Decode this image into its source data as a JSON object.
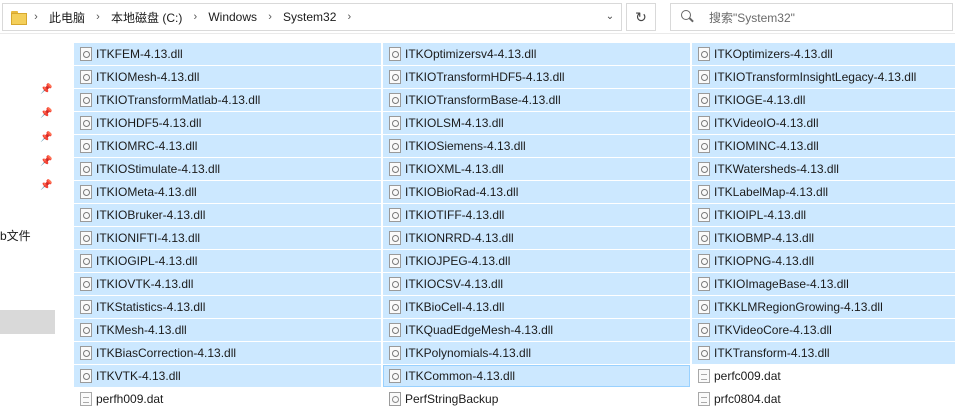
{
  "address": {
    "crumbs": [
      "此电脑",
      "本地磁盘 (C:)",
      "Windows",
      "System32"
    ],
    "dropdown_icon": "chevron-down-icon"
  },
  "refresh_icon": "refresh-icon",
  "search": {
    "placeholder": "搜索\"System32\""
  },
  "nav": {
    "partial_label": "b文件"
  },
  "files": [
    [
      {
        "name": "ITKFEM-4.13.dll",
        "icon": "dll",
        "state": "sel"
      },
      {
        "name": "ITKOptimizersv4-4.13.dll",
        "icon": "dll",
        "state": "sel"
      },
      {
        "name": "ITKOptimizers-4.13.dll",
        "icon": "dll",
        "state": "sel"
      }
    ],
    [
      {
        "name": "ITKIOMesh-4.13.dll",
        "icon": "dll",
        "state": "sel"
      },
      {
        "name": "ITKIOTransformHDF5-4.13.dll",
        "icon": "dll",
        "state": "sel"
      },
      {
        "name": "ITKIOTransformInsightLegacy-4.13.dll",
        "icon": "dll",
        "state": "sel"
      }
    ],
    [
      {
        "name": "ITKIOTransformMatlab-4.13.dll",
        "icon": "dll",
        "state": "sel"
      },
      {
        "name": "ITKIOTransformBase-4.13.dll",
        "icon": "dll",
        "state": "sel"
      },
      {
        "name": "ITKIOGE-4.13.dll",
        "icon": "dll",
        "state": "sel"
      }
    ],
    [
      {
        "name": "ITKIOHDF5-4.13.dll",
        "icon": "dll",
        "state": "sel"
      },
      {
        "name": "ITKIOLSM-4.13.dll",
        "icon": "dll",
        "state": "sel"
      },
      {
        "name": "ITKVideoIO-4.13.dll",
        "icon": "dll",
        "state": "sel"
      }
    ],
    [
      {
        "name": "ITKIOMRC-4.13.dll",
        "icon": "dll",
        "state": "sel"
      },
      {
        "name": "ITKIOSiemens-4.13.dll",
        "icon": "dll",
        "state": "sel"
      },
      {
        "name": "ITKIOMINC-4.13.dll",
        "icon": "dll",
        "state": "sel"
      }
    ],
    [
      {
        "name": "ITKIOStimulate-4.13.dll",
        "icon": "dll",
        "state": "sel"
      },
      {
        "name": "ITKIOXML-4.13.dll",
        "icon": "dll",
        "state": "sel"
      },
      {
        "name": "ITKWatersheds-4.13.dll",
        "icon": "dll",
        "state": "sel"
      }
    ],
    [
      {
        "name": "ITKIOMeta-4.13.dll",
        "icon": "dll",
        "state": "sel"
      },
      {
        "name": "ITKIOBioRad-4.13.dll",
        "icon": "dll",
        "state": "sel"
      },
      {
        "name": "ITKLabelMap-4.13.dll",
        "icon": "dll",
        "state": "sel"
      }
    ],
    [
      {
        "name": "ITKIOBruker-4.13.dll",
        "icon": "dll",
        "state": "sel"
      },
      {
        "name": "ITKIOTIFF-4.13.dll",
        "icon": "dll",
        "state": "sel"
      },
      {
        "name": "ITKIOIPL-4.13.dll",
        "icon": "dll",
        "state": "sel"
      }
    ],
    [
      {
        "name": "ITKIONIFTI-4.13.dll",
        "icon": "dll",
        "state": "sel"
      },
      {
        "name": "ITKIONRRD-4.13.dll",
        "icon": "dll",
        "state": "sel"
      },
      {
        "name": "ITKIOBMP-4.13.dll",
        "icon": "dll",
        "state": "sel"
      }
    ],
    [
      {
        "name": "ITKIOGIPL-4.13.dll",
        "icon": "dll",
        "state": "sel"
      },
      {
        "name": "ITKIOJPEG-4.13.dll",
        "icon": "dll",
        "state": "sel"
      },
      {
        "name": "ITKIOPNG-4.13.dll",
        "icon": "dll",
        "state": "sel"
      }
    ],
    [
      {
        "name": "ITKIOVTK-4.13.dll",
        "icon": "dll",
        "state": "sel"
      },
      {
        "name": "ITKIOCSV-4.13.dll",
        "icon": "dll",
        "state": "sel"
      },
      {
        "name": "ITKIOImageBase-4.13.dll",
        "icon": "dll",
        "state": "sel"
      }
    ],
    [
      {
        "name": "ITKStatistics-4.13.dll",
        "icon": "dll",
        "state": "sel"
      },
      {
        "name": "ITKBioCell-4.13.dll",
        "icon": "dll",
        "state": "sel"
      },
      {
        "name": "ITKKLMRegionGrowing-4.13.dll",
        "icon": "dll",
        "state": "sel"
      }
    ],
    [
      {
        "name": "ITKMesh-4.13.dll",
        "icon": "dll",
        "state": "sel"
      },
      {
        "name": "ITKQuadEdgeMesh-4.13.dll",
        "icon": "dll",
        "state": "sel"
      },
      {
        "name": "ITKVideoCore-4.13.dll",
        "icon": "dll",
        "state": "sel"
      }
    ],
    [
      {
        "name": "ITKBiasCorrection-4.13.dll",
        "icon": "dll",
        "state": "sel"
      },
      {
        "name": "ITKPolynomials-4.13.dll",
        "icon": "dll",
        "state": "sel"
      },
      {
        "name": "ITKTransform-4.13.dll",
        "icon": "dll",
        "state": "sel"
      }
    ],
    [
      {
        "name": "ITKVTK-4.13.dll",
        "icon": "dll",
        "state": "sel"
      },
      {
        "name": "ITKCommon-4.13.dll",
        "icon": "dll",
        "state": "focus"
      },
      {
        "name": "perfc009.dat",
        "icon": "plain",
        "state": "none"
      }
    ],
    [
      {
        "name": "perfh009.dat",
        "icon": "plain",
        "state": "none"
      },
      {
        "name": "PerfStringBackup",
        "icon": "gear",
        "state": "none"
      },
      {
        "name": "prfc0804.dat",
        "icon": "plain",
        "state": "none"
      }
    ]
  ],
  "colors": {
    "selection": "#cce8ff",
    "focus_border": "#99d1ff",
    "nav_selected": "#d9d9d9"
  }
}
